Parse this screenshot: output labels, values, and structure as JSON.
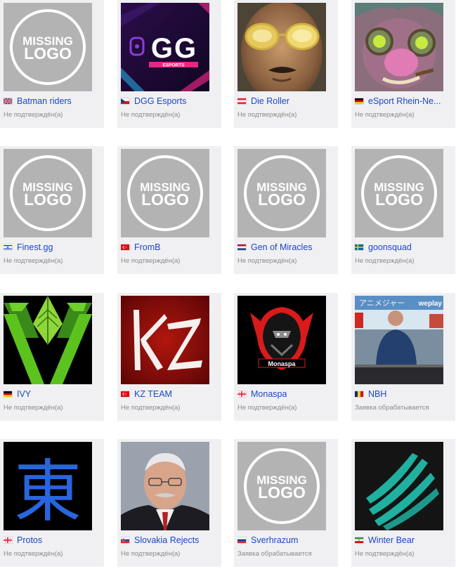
{
  "teams": [
    {
      "name": "Batman riders",
      "status": "Не подтверждён(а)",
      "flag": "gb-flag-icon",
      "logo": "missing-logo"
    },
    {
      "name": "DGG Esports",
      "status": "Не подтверждён(а)",
      "flag": "cz-flag-icon",
      "logo": "dgg-logo"
    },
    {
      "name": "Die Roller",
      "status": "Не подтверждён(а)",
      "flag": "at-flag-icon",
      "logo": "die-roller-photo"
    },
    {
      "name": "eSport Rhein-Ne...",
      "status": "Не подтверждён(а)",
      "flag": "de-flag-icon",
      "logo": "goblin-logo"
    },
    {
      "name": "Finest.gg",
      "status": "Не подтверждён(а)",
      "flag": "il-flag-icon",
      "logo": "missing-logo"
    },
    {
      "name": "FromB",
      "status": "Не подтверждён(а)",
      "flag": "tr-flag-icon",
      "logo": "missing-logo"
    },
    {
      "name": "Gen of Miracles",
      "status": "Не подтверждён(а)",
      "flag": "nl-flag-icon",
      "logo": "missing-logo"
    },
    {
      "name": "goonsquad",
      "status": "Не подтверждён(а)",
      "flag": "se-flag-icon",
      "logo": "missing-logo"
    },
    {
      "name": "IVY",
      "status": "Не подтверждён(а)",
      "flag": "de-flag-icon",
      "logo": "ivy-logo"
    },
    {
      "name": "KZ TEAM",
      "status": "Не подтверждён(а)",
      "flag": "tr-flag-icon",
      "logo": "kz-logo"
    },
    {
      "name": "Monaspa",
      "status": "Не подтверждён(а)",
      "flag": "ge-flag-icon",
      "logo": "monaspa-logo"
    },
    {
      "name": "NBH",
      "status": "Заявка обрабатывается",
      "flag": "ro-flag-icon",
      "logo": "nbh-photo"
    },
    {
      "name": "Protos",
      "status": "Не подтверждён(а)",
      "flag": "ge-flag-icon",
      "logo": "protos-logo"
    },
    {
      "name": "Slovakia Rejects",
      "status": "Не подтверждён(а)",
      "flag": "sk-flag-icon",
      "logo": "slovakia-photo"
    },
    {
      "name": "Sverhrazum",
      "status": "Заявка обрабатывается",
      "flag": "ru-flag-icon",
      "logo": "missing-logo"
    },
    {
      "name": "Winter Bear",
      "status": "Не подтверждён(а)",
      "flag": "ir-flag-icon",
      "logo": "winter-bear-logo"
    }
  ],
  "logo_text": {
    "missing_line1": "MISSING",
    "missing_line2": "LOGO",
    "dgg": "GG",
    "dgg_sub": "ESPORTS",
    "kz": "KZ",
    "monaspa": "Monaspa",
    "protos": "東",
    "nbh_banner": "アニメジャー",
    "nbh_brand": "weplay"
  },
  "colors": {
    "link": "#1a46c8",
    "status": "#8a8a8a",
    "card_bg": "#f0f0f2",
    "missing_logo_bg": "#b3b3b3"
  }
}
